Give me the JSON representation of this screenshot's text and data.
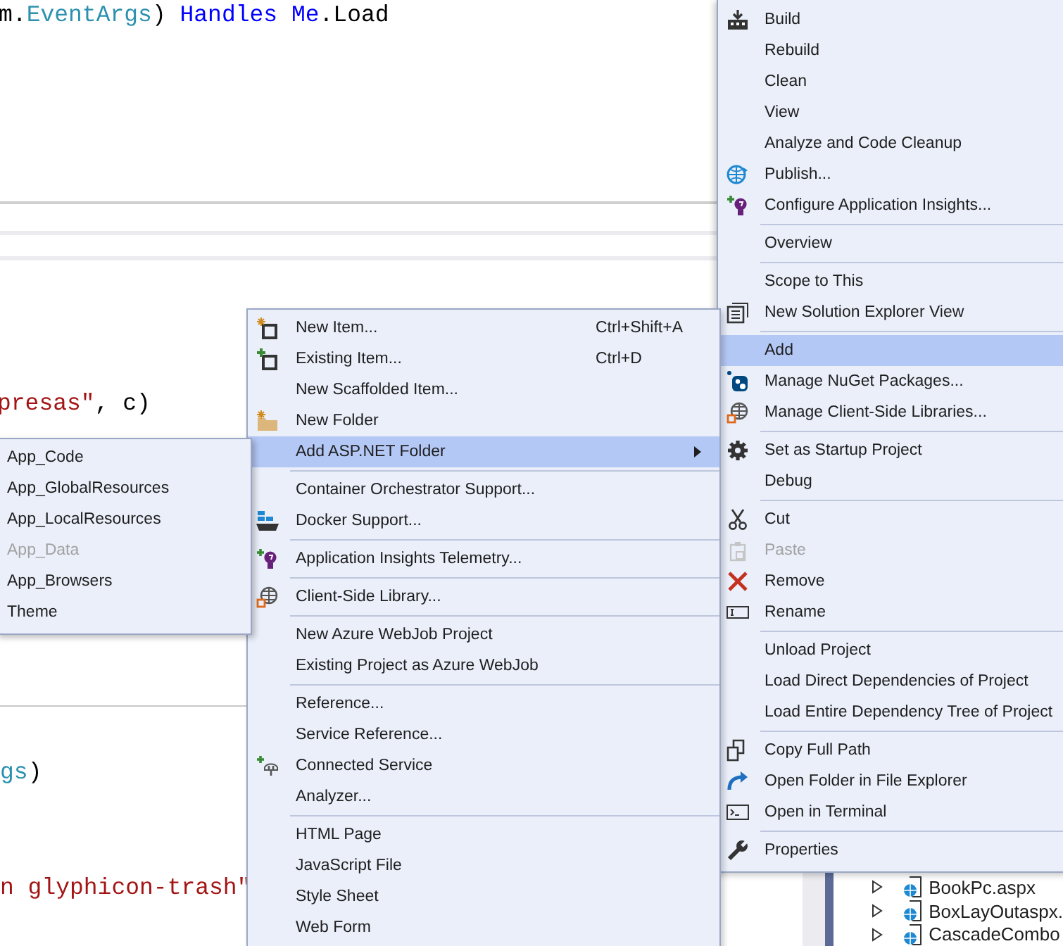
{
  "editor": {
    "code_lines": [
      {
        "segments": [
          {
            "text": "m.",
            "kind": "plain"
          },
          {
            "text": "EventArgs",
            "kind": "type"
          },
          {
            "text": ") ",
            "kind": "plain"
          },
          {
            "text": "Handles Me",
            "kind": "keyword"
          },
          {
            "text": ".Load",
            "kind": "plain"
          }
        ]
      },
      {
        "segments": [
          {
            "text": "presas\"",
            "kind": "string"
          },
          {
            "text": ", c)",
            "kind": "plain"
          }
        ]
      },
      {
        "segments": [
          {
            "text": "gs",
            "kind": "type"
          },
          {
            "text": ")",
            "kind": "plain"
          }
        ]
      },
      {
        "segments": [
          {
            "text": "n glyphicon-trash\"",
            "kind": "string"
          }
        ]
      }
    ]
  },
  "solution_explorer": {
    "items": [
      {
        "label": "BookPc.aspx",
        "expanded": false
      },
      {
        "label": "BoxLayOutaspx.",
        "expanded": false
      },
      {
        "label": "CascadeCombo",
        "expanded": false
      }
    ]
  },
  "context_menu": {
    "items": [
      {
        "kind": "item",
        "label": "Build",
        "selected": false,
        "disabled": false
      },
      {
        "kind": "item",
        "label": "Rebuild",
        "selected": false,
        "disabled": false
      },
      {
        "kind": "item",
        "label": "Clean",
        "selected": false,
        "disabled": false
      },
      {
        "kind": "item",
        "label": "View",
        "selected": false,
        "disabled": false
      },
      {
        "kind": "item",
        "label": "Analyze and Code Cleanup",
        "selected": false,
        "disabled": false
      },
      {
        "kind": "item",
        "label": "Publish...",
        "selected": false,
        "disabled": false
      },
      {
        "kind": "item",
        "label": "Configure Application Insights...",
        "selected": false,
        "disabled": false
      },
      {
        "kind": "separator"
      },
      {
        "kind": "item",
        "label": "Overview",
        "selected": false,
        "disabled": false
      },
      {
        "kind": "separator"
      },
      {
        "kind": "item",
        "label": "Scope to This",
        "selected": false,
        "disabled": false
      },
      {
        "kind": "item",
        "label": "New Solution Explorer View",
        "selected": false,
        "disabled": false
      },
      {
        "kind": "separator"
      },
      {
        "kind": "item",
        "label": "Add",
        "selected": true,
        "disabled": false
      },
      {
        "kind": "item",
        "label": "Manage NuGet Packages...",
        "selected": false,
        "disabled": false
      },
      {
        "kind": "item",
        "label": "Manage Client-Side Libraries...",
        "selected": false,
        "disabled": false
      },
      {
        "kind": "separator"
      },
      {
        "kind": "item",
        "label": "Set as Startup Project",
        "selected": false,
        "disabled": false
      },
      {
        "kind": "item",
        "label": "Debug",
        "selected": false,
        "disabled": false
      },
      {
        "kind": "separator"
      },
      {
        "kind": "item",
        "label": "Cut",
        "selected": false,
        "disabled": false
      },
      {
        "kind": "item",
        "label": "Paste",
        "selected": false,
        "disabled": true
      },
      {
        "kind": "item",
        "label": "Remove",
        "selected": false,
        "disabled": false
      },
      {
        "kind": "item",
        "label": "Rename",
        "selected": false,
        "disabled": false
      },
      {
        "kind": "separator"
      },
      {
        "kind": "item",
        "label": "Unload Project",
        "selected": false,
        "disabled": false
      },
      {
        "kind": "item",
        "label": "Load Direct Dependencies of Project",
        "selected": false,
        "disabled": false
      },
      {
        "kind": "item",
        "label": "Load Entire Dependency Tree of Project",
        "selected": false,
        "disabled": false
      },
      {
        "kind": "separator"
      },
      {
        "kind": "item",
        "label": "Copy Full Path",
        "selected": false,
        "disabled": false
      },
      {
        "kind": "item",
        "label": "Open Folder in File Explorer",
        "selected": false,
        "disabled": false
      },
      {
        "kind": "item",
        "label": "Open in Terminal",
        "selected": false,
        "disabled": false
      },
      {
        "kind": "separator"
      },
      {
        "kind": "item",
        "label": "Properties",
        "selected": false,
        "disabled": false
      }
    ]
  },
  "add_menu": {
    "items": [
      {
        "kind": "item",
        "label": "New Item...",
        "shortcut": "Ctrl+Shift+A",
        "selected": false,
        "disabled": false
      },
      {
        "kind": "item",
        "label": "Existing Item...",
        "shortcut": "Ctrl+D",
        "selected": false,
        "disabled": false
      },
      {
        "kind": "item",
        "label": "New Scaffolded Item...",
        "selected": false,
        "disabled": false
      },
      {
        "kind": "item",
        "label": "New Folder",
        "selected": false,
        "disabled": false
      },
      {
        "kind": "item",
        "label": "Add ASP.NET Folder",
        "has_submenu": true,
        "selected": true,
        "disabled": false
      },
      {
        "kind": "separator"
      },
      {
        "kind": "item",
        "label": "Container Orchestrator Support...",
        "selected": false,
        "disabled": false
      },
      {
        "kind": "item",
        "label": "Docker Support...",
        "selected": false,
        "disabled": false
      },
      {
        "kind": "separator"
      },
      {
        "kind": "item",
        "label": "Application Insights Telemetry...",
        "selected": false,
        "disabled": false
      },
      {
        "kind": "separator"
      },
      {
        "kind": "item",
        "label": "Client-Side Library...",
        "selected": false,
        "disabled": false
      },
      {
        "kind": "separator"
      },
      {
        "kind": "item",
        "label": "New Azure WebJob Project",
        "selected": false,
        "disabled": false
      },
      {
        "kind": "item",
        "label": "Existing Project as Azure WebJob",
        "selected": false,
        "disabled": false
      },
      {
        "kind": "separator"
      },
      {
        "kind": "item",
        "label": "Reference...",
        "selected": false,
        "disabled": false
      },
      {
        "kind": "item",
        "label": "Service Reference...",
        "selected": false,
        "disabled": false
      },
      {
        "kind": "item",
        "label": "Connected Service",
        "selected": false,
        "disabled": false
      },
      {
        "kind": "item",
        "label": "Analyzer...",
        "selected": false,
        "disabled": false
      },
      {
        "kind": "separator"
      },
      {
        "kind": "item",
        "label": "HTML Page",
        "selected": false,
        "disabled": false
      },
      {
        "kind": "item",
        "label": "JavaScript File",
        "selected": false,
        "disabled": false
      },
      {
        "kind": "item",
        "label": "Style Sheet",
        "selected": false,
        "disabled": false
      },
      {
        "kind": "item",
        "label": "Web Form",
        "selected": false,
        "disabled": false
      }
    ]
  },
  "asp_net_folder_menu": {
    "items": [
      {
        "kind": "item",
        "label": "App_Code",
        "selected": false,
        "disabled": false
      },
      {
        "kind": "item",
        "label": "App_GlobalResources",
        "selected": false,
        "disabled": false
      },
      {
        "kind": "item",
        "label": "App_LocalResources",
        "selected": false,
        "disabled": false
      },
      {
        "kind": "item",
        "label": "App_Data",
        "selected": false,
        "disabled": true
      },
      {
        "kind": "item",
        "label": "App_Browsers",
        "selected": false,
        "disabled": false
      },
      {
        "kind": "item",
        "label": "Theme",
        "selected": false,
        "disabled": false
      }
    ]
  }
}
